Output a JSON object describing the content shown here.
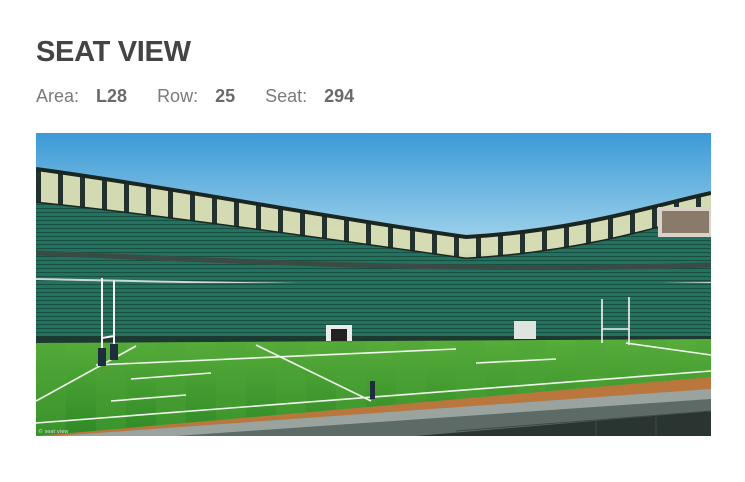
{
  "page": {
    "title": "SEAT VIEW"
  },
  "seat": {
    "area_label": "Area:",
    "area_value": "L28",
    "row_label": "Row:",
    "row_value": "25",
    "seat_label": "Seat:",
    "seat_value": "294"
  },
  "image": {
    "alt": "View of the rugby pitch from the seat",
    "credit": "© seat view"
  },
  "colors": {
    "sky_top": "#3b9ad6",
    "sky_bottom": "#a9d8ee",
    "seats": "#1f6f5e",
    "pitch": "#3f9a2f",
    "title": "#444444"
  }
}
